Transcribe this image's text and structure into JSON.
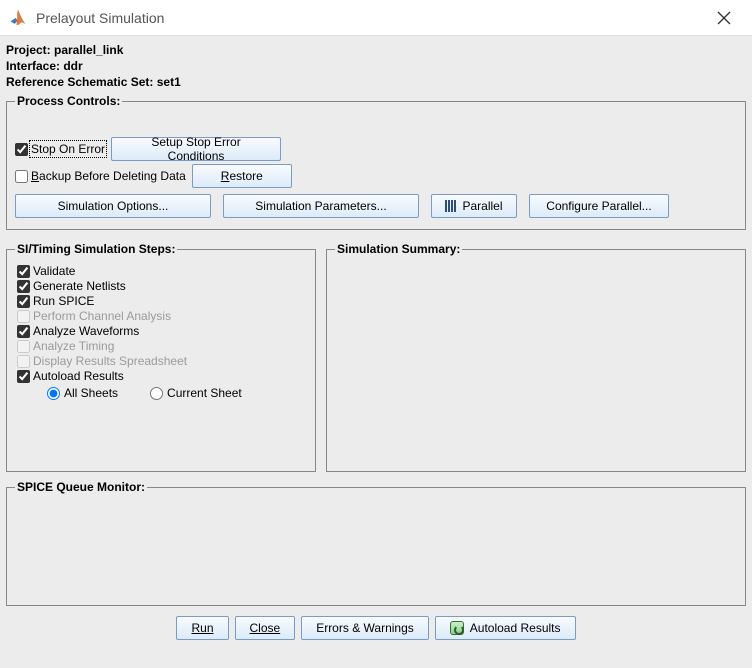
{
  "window": {
    "title": "Prelayout Simulation"
  },
  "info": {
    "project": "Project: parallel_link",
    "interface": "Interface: ddr",
    "refset": "Reference Schematic Set: set1"
  },
  "process_controls": {
    "legend": "Process Controls:",
    "stop_on_error": "Stop On Error",
    "setup_stop": "Setup Stop Error Conditions",
    "backup": "Backup Before Deleting Data",
    "restore": "Restore",
    "sim_options": "Simulation Options...",
    "sim_params": "Simulation Parameters...",
    "parallel": "Parallel",
    "config_parallel": "Configure Parallel..."
  },
  "steps": {
    "legend": "SI/Timing Simulation Steps:",
    "validate": "Validate",
    "gen_netlists": "Generate Netlists",
    "run_spice": "Run SPICE",
    "perform_channel": "Perform Channel Analysis",
    "analyze_wave": "Analyze Waveforms",
    "analyze_timing": "Analyze Timing",
    "display_results": "Display Results Spreadsheet",
    "autoload": "Autoload Results",
    "all_sheets": "All Sheets",
    "current_sheet": "Current Sheet"
  },
  "summary": {
    "legend": "Simulation Summary:"
  },
  "queue": {
    "legend": "SPICE Queue Monitor:"
  },
  "footer": {
    "run": "Run",
    "close": "Close",
    "errors": "Errors & Warnings",
    "autoload_results": "Autoload Results"
  }
}
